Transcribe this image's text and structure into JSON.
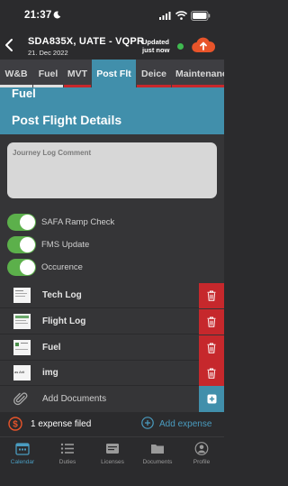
{
  "status_bar": {
    "time": "21:37"
  },
  "header": {
    "title": "SDA835X, UATE - VQPR",
    "date": "21. Dec 2022",
    "updated_line1": "Updated",
    "updated_line2": "just now"
  },
  "tabs": [
    {
      "label": "W&B",
      "bar_color": "#e0e0e0"
    },
    {
      "label": "Fuel",
      "bar_color": "#e0e0e0"
    },
    {
      "label": "MVT",
      "bar_color": "#c6282c"
    },
    {
      "label": "Post Flt",
      "active": true
    },
    {
      "label": "Deice",
      "bar_color": "#c6282c"
    },
    {
      "label": "Maintenance",
      "bar_color": "#c6282c"
    }
  ],
  "section": {
    "prev_heading": "Fuel",
    "title": "Post Flight Details"
  },
  "journey_log": {
    "placeholder": "Journey Log Comment",
    "value": ""
  },
  "toggles": [
    {
      "label": "SAFA Ramp Check",
      "on": true
    },
    {
      "label": "FMS Update",
      "on": true
    },
    {
      "label": "Occurence",
      "on": true
    }
  ],
  "documents": [
    {
      "name": "Tech Log",
      "thumb_text": ""
    },
    {
      "name": "Flight Log",
      "thumb_text": ""
    },
    {
      "name": "Fuel",
      "thumb_text": ""
    },
    {
      "name": "img",
      "thumb_text": "as Arit"
    }
  ],
  "add_documents_label": "Add Documents",
  "expense": {
    "count_text": "1 expense filed",
    "add_label": "Add expense"
  },
  "bottom_nav": [
    {
      "label": "Calendar",
      "icon": "calendar-icon",
      "active": true
    },
    {
      "label": "Duties",
      "icon": "list-icon"
    },
    {
      "label": "Licenses",
      "icon": "license-icon"
    },
    {
      "label": "Documents",
      "icon": "folder-icon"
    },
    {
      "label": "Profile",
      "icon": "person-icon"
    }
  ],
  "colors": {
    "accent_blue": "#418fab",
    "delete_red": "#c6282c",
    "toggle_green": "#5cb04b",
    "status_green": "#3fb950",
    "cloud_orange": "#e8542a"
  }
}
